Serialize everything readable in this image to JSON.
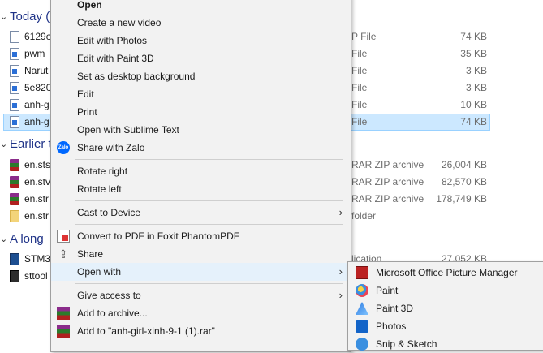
{
  "explorer": {
    "groups": [
      {
        "label": "Today (",
        "top": 0
      },
      {
        "label": "Earlier t",
        "top": 0
      },
      {
        "label": "A long",
        "top": 0
      }
    ],
    "rows": [
      {
        "name": "6129c",
        "type": "P File",
        "size": "74 KB",
        "icon": "document-icon"
      },
      {
        "name": "pwm",
        "type": "File",
        "size": "35 KB",
        "icon": "image-file-icon"
      },
      {
        "name": "Narut",
        "type": "File",
        "size": "3 KB",
        "icon": "image-file-icon"
      },
      {
        "name": "5e820",
        "type": "File",
        "size": "3 KB",
        "icon": "image-file-icon"
      },
      {
        "name": "anh-gi",
        "type": "File",
        "size": "10 KB",
        "icon": "image-file-icon"
      },
      {
        "name": "anh-g",
        "type": "File",
        "size": "74 KB",
        "icon": "image-file-icon",
        "selected": true
      },
      {
        "name": "en.sts",
        "type": "RAR ZIP archive",
        "size": "26,004 KB",
        "icon": "winrar-icon"
      },
      {
        "name": "en.stv",
        "type": "RAR ZIP archive",
        "size": "82,570 KB",
        "icon": "winrar-icon"
      },
      {
        "name": "en.str",
        "type": "RAR ZIP archive",
        "size": "178,749 KB",
        "icon": "winrar-icon"
      },
      {
        "name": "en.str",
        "type": "folder",
        "size": "",
        "icon": "folder-icon"
      },
      {
        "name": "STM3",
        "type": "lication",
        "size": "27,052 KB",
        "icon": "app-icon"
      },
      {
        "name": "sttool",
        "type": "",
        "size": "",
        "icon": "app-icon"
      }
    ]
  },
  "context_menu": {
    "items": [
      {
        "label": "Open",
        "bold": true
      },
      {
        "label": "Create a new video"
      },
      {
        "label": "Edit with Photos"
      },
      {
        "label": "Edit with Paint 3D"
      },
      {
        "label": "Set as desktop background"
      },
      {
        "label": "Edit"
      },
      {
        "label": "Print"
      },
      {
        "label": "Open with Sublime Text"
      },
      {
        "label": "Share with Zalo",
        "icon": "zalo-icon"
      },
      {
        "label": "Rotate right"
      },
      {
        "label": "Rotate left"
      },
      {
        "label": "Cast to Device",
        "submenu": true
      },
      {
        "label": "Convert to PDF in Foxit PhantomPDF",
        "icon": "foxit-pdf-icon"
      },
      {
        "label": "Share",
        "icon": "share-icon"
      },
      {
        "label": "Open with",
        "submenu": true,
        "hover": true
      },
      {
        "label": "Give access to",
        "submenu": true
      },
      {
        "label": "Add to archive...",
        "icon": "winrar-icon"
      },
      {
        "label": "Add to \"anh-girl-xinh-9-1 (1).rar\"",
        "icon": "winrar-icon"
      }
    ],
    "arrow_glyph": "›"
  },
  "open_with_submenu": {
    "items": [
      {
        "label": "Microsoft Office Picture Manager",
        "icon": "picture-manager-icon"
      },
      {
        "label": "Paint",
        "icon": "paint-icon"
      },
      {
        "label": "Paint 3D",
        "icon": "paint-3d-icon"
      },
      {
        "label": "Photos",
        "icon": "photos-icon"
      },
      {
        "label": "Snip & Sketch",
        "icon": "snip-sketch-icon"
      }
    ]
  },
  "colors": {
    "accent_text": "#1e3287",
    "selection_bg": "#cce8ff",
    "menu_bg": "#f2f2f2",
    "menu_hover": "#e5f1fb"
  }
}
